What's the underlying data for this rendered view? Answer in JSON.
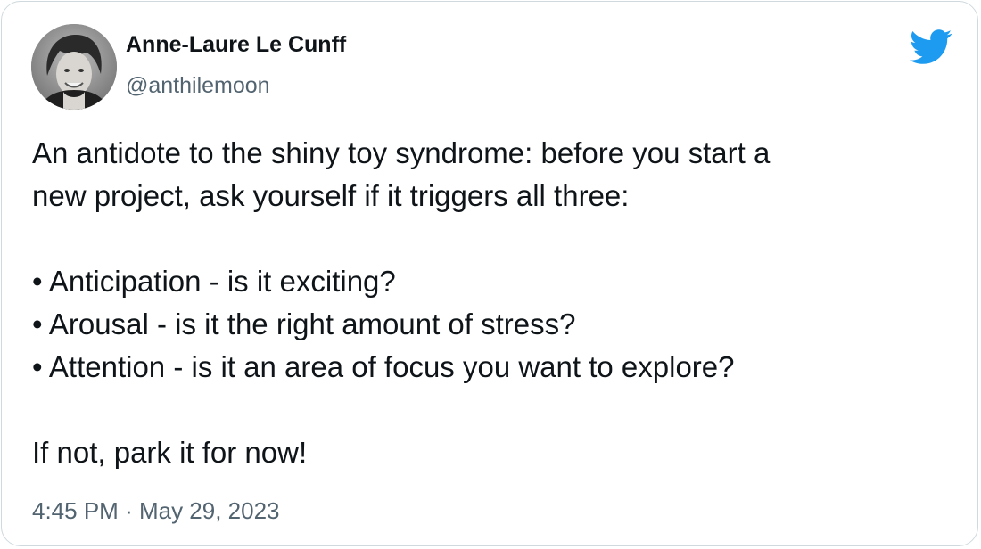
{
  "author": {
    "display_name": "Anne-Laure Le Cunff",
    "handle": "@anthilemoon"
  },
  "tweet": {
    "lines": [
      "An antidote to the shiny toy syndrome: before you start a",
      "new project, ask yourself if it triggers all three:",
      "",
      "• Anticipation - is it exciting?",
      "• Arousal - is it the right amount of stress?",
      "• Attention - is it an area of focus you want to explore?",
      "",
      "If not, park it for now!"
    ],
    "time": "4:45 PM",
    "separator": "·",
    "date": "May 29, 2023"
  },
  "icons": {
    "brand": "twitter-bird-icon",
    "avatar": "profile-photo"
  },
  "colors": {
    "brand": "#1d9bf0",
    "text_primary": "#0f1419",
    "text_secondary": "#536471",
    "border": "#cfd9de"
  }
}
